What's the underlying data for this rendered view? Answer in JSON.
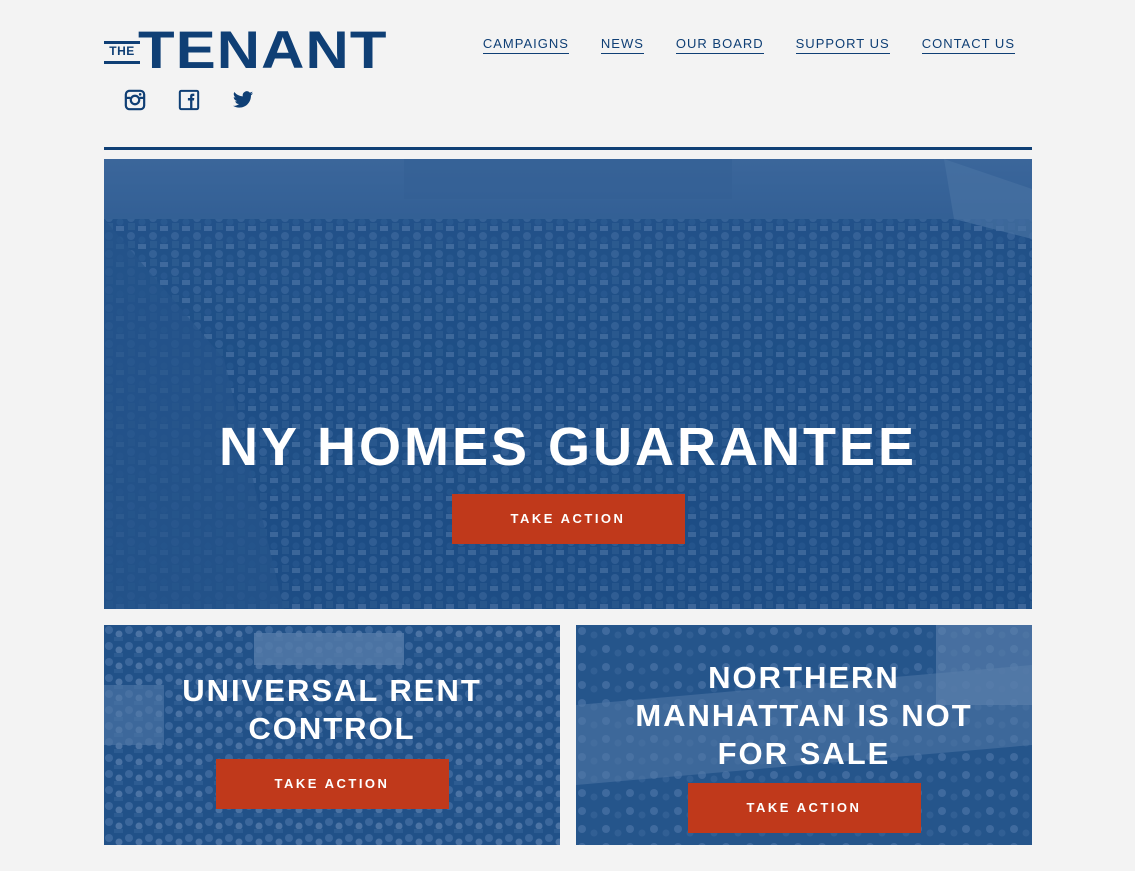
{
  "brand": {
    "prefix": "THE",
    "name": "TENANT",
    "color": "#0f3f75"
  },
  "social": [
    {
      "icon": "instagram-icon"
    },
    {
      "icon": "facebook-icon"
    },
    {
      "icon": "twitter-icon"
    }
  ],
  "nav": {
    "items": [
      {
        "label": "CAMPAIGNS"
      },
      {
        "label": "NEWS"
      },
      {
        "label": "OUR BOARD"
      },
      {
        "label": "SUPPORT US"
      },
      {
        "label": "CONTACT US"
      }
    ]
  },
  "hero": {
    "title": "NY HOMES GUARANTEE",
    "cta": "TAKE ACTION"
  },
  "cards": [
    {
      "title": "UNIVERSAL RENT CONTROL",
      "cta": "TAKE ACTION"
    },
    {
      "title": "NORTHERN MANHATTAN IS NOT FOR SALE",
      "cta": "TAKE ACTION"
    }
  ],
  "colors": {
    "accent": "#c0391b",
    "overlay": "#1f5a99",
    "background": "#f3f3f3"
  }
}
